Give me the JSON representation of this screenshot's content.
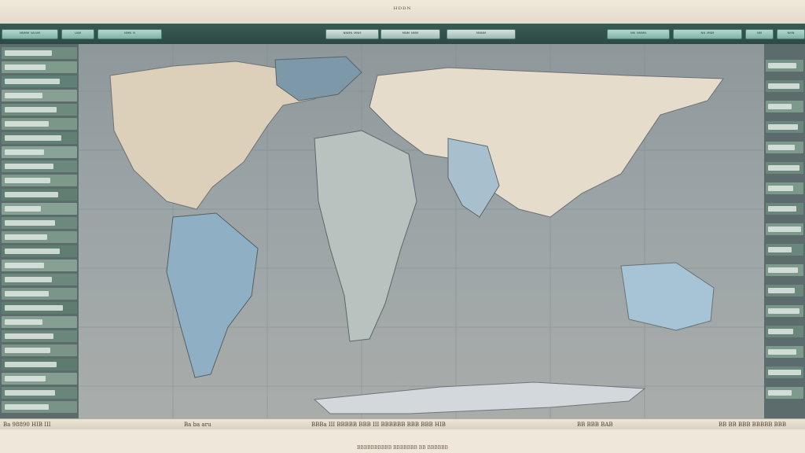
{
  "app": {
    "title": "ᴴᴰᴰᴺ",
    "colors": {
      "toolbar": "#2f4d48",
      "button": "#8fc2b6",
      "ocean": "#9aa3a6",
      "land": "#d8cdbb",
      "sidebar": "#5c6b6c",
      "chrome": "#e8e1d3"
    }
  },
  "toolbar": {
    "left_buttons": [
      "ᴺᴺᴹᴹ ᵂᴸᴺᴹ",
      "ᴸᴺᴹ",
      "ᴺᴹᴺ ᴺ"
    ],
    "center_tabs": [
      "ᴺᴺᴹᴺ ᴹᴺᴹ",
      "ᴹᴺᴹ ᴺᴹᴹ",
      "ᴹᴺᴺᴹ"
    ],
    "right_buttons": [
      "ᴺᴹ ᴺᴹᴹᴺ",
      "ᴺᴺ ᴹᴺᴹ",
      "ᴺᴹ",
      "ᴺᴹᴺ"
    ]
  },
  "status": {
    "left": "Ba 98890 HIB III",
    "center_left": "Ba ba aru",
    "center": "BBBa III BBBBB BBB III BBBBBB BBB BBB HIB",
    "center_right": "BB BBB BAB",
    "right": "BB BB BBB BBBBB BBB"
  },
  "footer": {
    "caption": "BBBBBBBBBB BBBBBBB BB BBBBBB"
  }
}
